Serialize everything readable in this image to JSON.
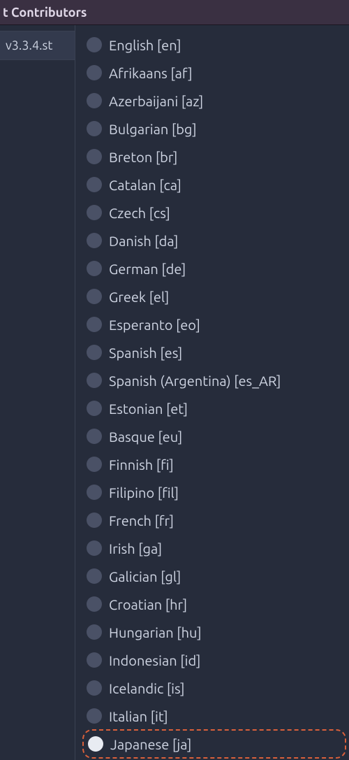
{
  "titlebar": {
    "text": "t Contributors"
  },
  "sidebar": {
    "version_tab": "v3.3.4.st"
  },
  "language_list": {
    "items": [
      {
        "label": "English [en]",
        "selected": false,
        "highlighted": false
      },
      {
        "label": "Afrikaans [af]",
        "selected": false,
        "highlighted": false
      },
      {
        "label": "Azerbaijani [az]",
        "selected": false,
        "highlighted": false
      },
      {
        "label": "Bulgarian [bg]",
        "selected": false,
        "highlighted": false
      },
      {
        "label": "Breton [br]",
        "selected": false,
        "highlighted": false
      },
      {
        "label": "Catalan [ca]",
        "selected": false,
        "highlighted": false
      },
      {
        "label": "Czech [cs]",
        "selected": false,
        "highlighted": false
      },
      {
        "label": "Danish [da]",
        "selected": false,
        "highlighted": false
      },
      {
        "label": "German [de]",
        "selected": false,
        "highlighted": false
      },
      {
        "label": "Greek [el]",
        "selected": false,
        "highlighted": false
      },
      {
        "label": "Esperanto [eo]",
        "selected": false,
        "highlighted": false
      },
      {
        "label": "Spanish [es]",
        "selected": false,
        "highlighted": false
      },
      {
        "label": "Spanish (Argentina) [es_AR]",
        "selected": false,
        "highlighted": false
      },
      {
        "label": "Estonian [et]",
        "selected": false,
        "highlighted": false
      },
      {
        "label": "Basque [eu]",
        "selected": false,
        "highlighted": false
      },
      {
        "label": "Finnish [fi]",
        "selected": false,
        "highlighted": false
      },
      {
        "label": "Filipino [fil]",
        "selected": false,
        "highlighted": false
      },
      {
        "label": "French [fr]",
        "selected": false,
        "highlighted": false
      },
      {
        "label": "Irish [ga]",
        "selected": false,
        "highlighted": false
      },
      {
        "label": "Galician [gl]",
        "selected": false,
        "highlighted": false
      },
      {
        "label": "Croatian [hr]",
        "selected": false,
        "highlighted": false
      },
      {
        "label": "Hungarian [hu]",
        "selected": false,
        "highlighted": false
      },
      {
        "label": "Indonesian [id]",
        "selected": false,
        "highlighted": false
      },
      {
        "label": "Icelandic [is]",
        "selected": false,
        "highlighted": false
      },
      {
        "label": "Italian [it]",
        "selected": false,
        "highlighted": false
      },
      {
        "label": "Japanese [ja]",
        "selected": true,
        "highlighted": true
      }
    ]
  }
}
